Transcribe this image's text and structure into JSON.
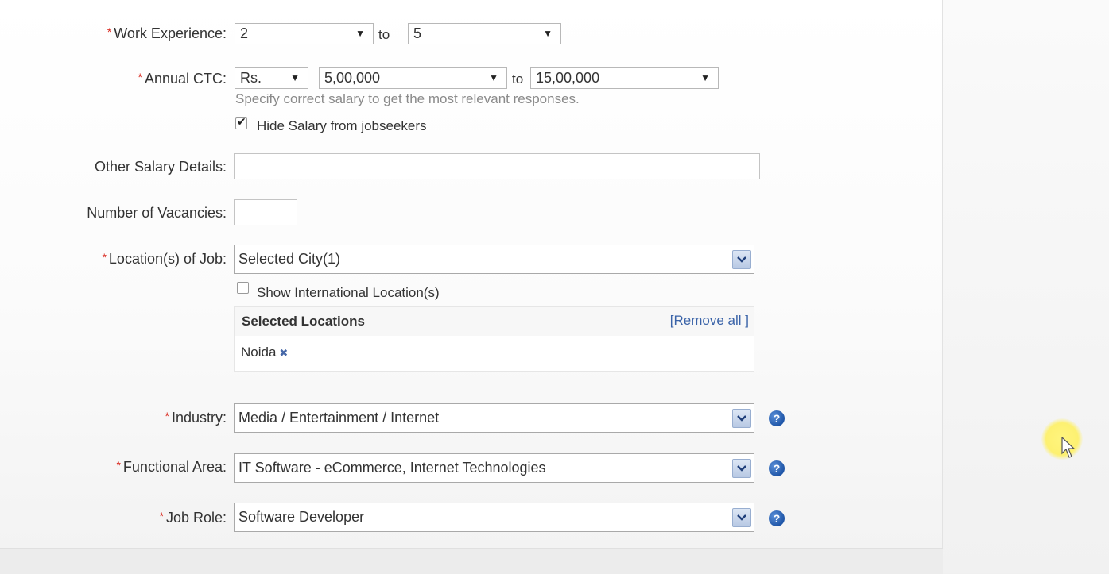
{
  "form": {
    "work_experience": {
      "label": "Work Experience:",
      "min": "2",
      "to": "to",
      "max": "5"
    },
    "annual_ctc": {
      "label": "Annual CTC:",
      "currency": "Rs.",
      "min": "5,00,000",
      "to": "to",
      "max": "15,00,000",
      "hint": "Specify correct salary to get the most relevant responses.",
      "hide_salary_label": "Hide Salary from jobseekers",
      "hide_salary_checked": true
    },
    "other_salary": {
      "label": "Other Salary Details:",
      "value": ""
    },
    "vacancies": {
      "label": "Number of Vacancies:",
      "value": ""
    },
    "locations": {
      "label": "Location(s) of Job:",
      "value": "Selected City(1)",
      "international_label": "Show International Location(s)",
      "international_checked": false,
      "selected_title": "Selected Locations",
      "remove_all": "[Remove all ]",
      "selected": [
        "Noida"
      ]
    },
    "industry": {
      "label": "Industry:",
      "value": "Media / Entertainment / Internet"
    },
    "functional_area": {
      "label": "Functional Area:",
      "value": "IT Software - eCommerce, Internet Technologies"
    },
    "job_role": {
      "label": "Job Role:",
      "value": "Software Developer"
    },
    "required_mark": "*",
    "help_icon": "?"
  },
  "colors": {
    "required": "#d9261c",
    "link": "#3a63a8",
    "help": "#1f56a8"
  }
}
